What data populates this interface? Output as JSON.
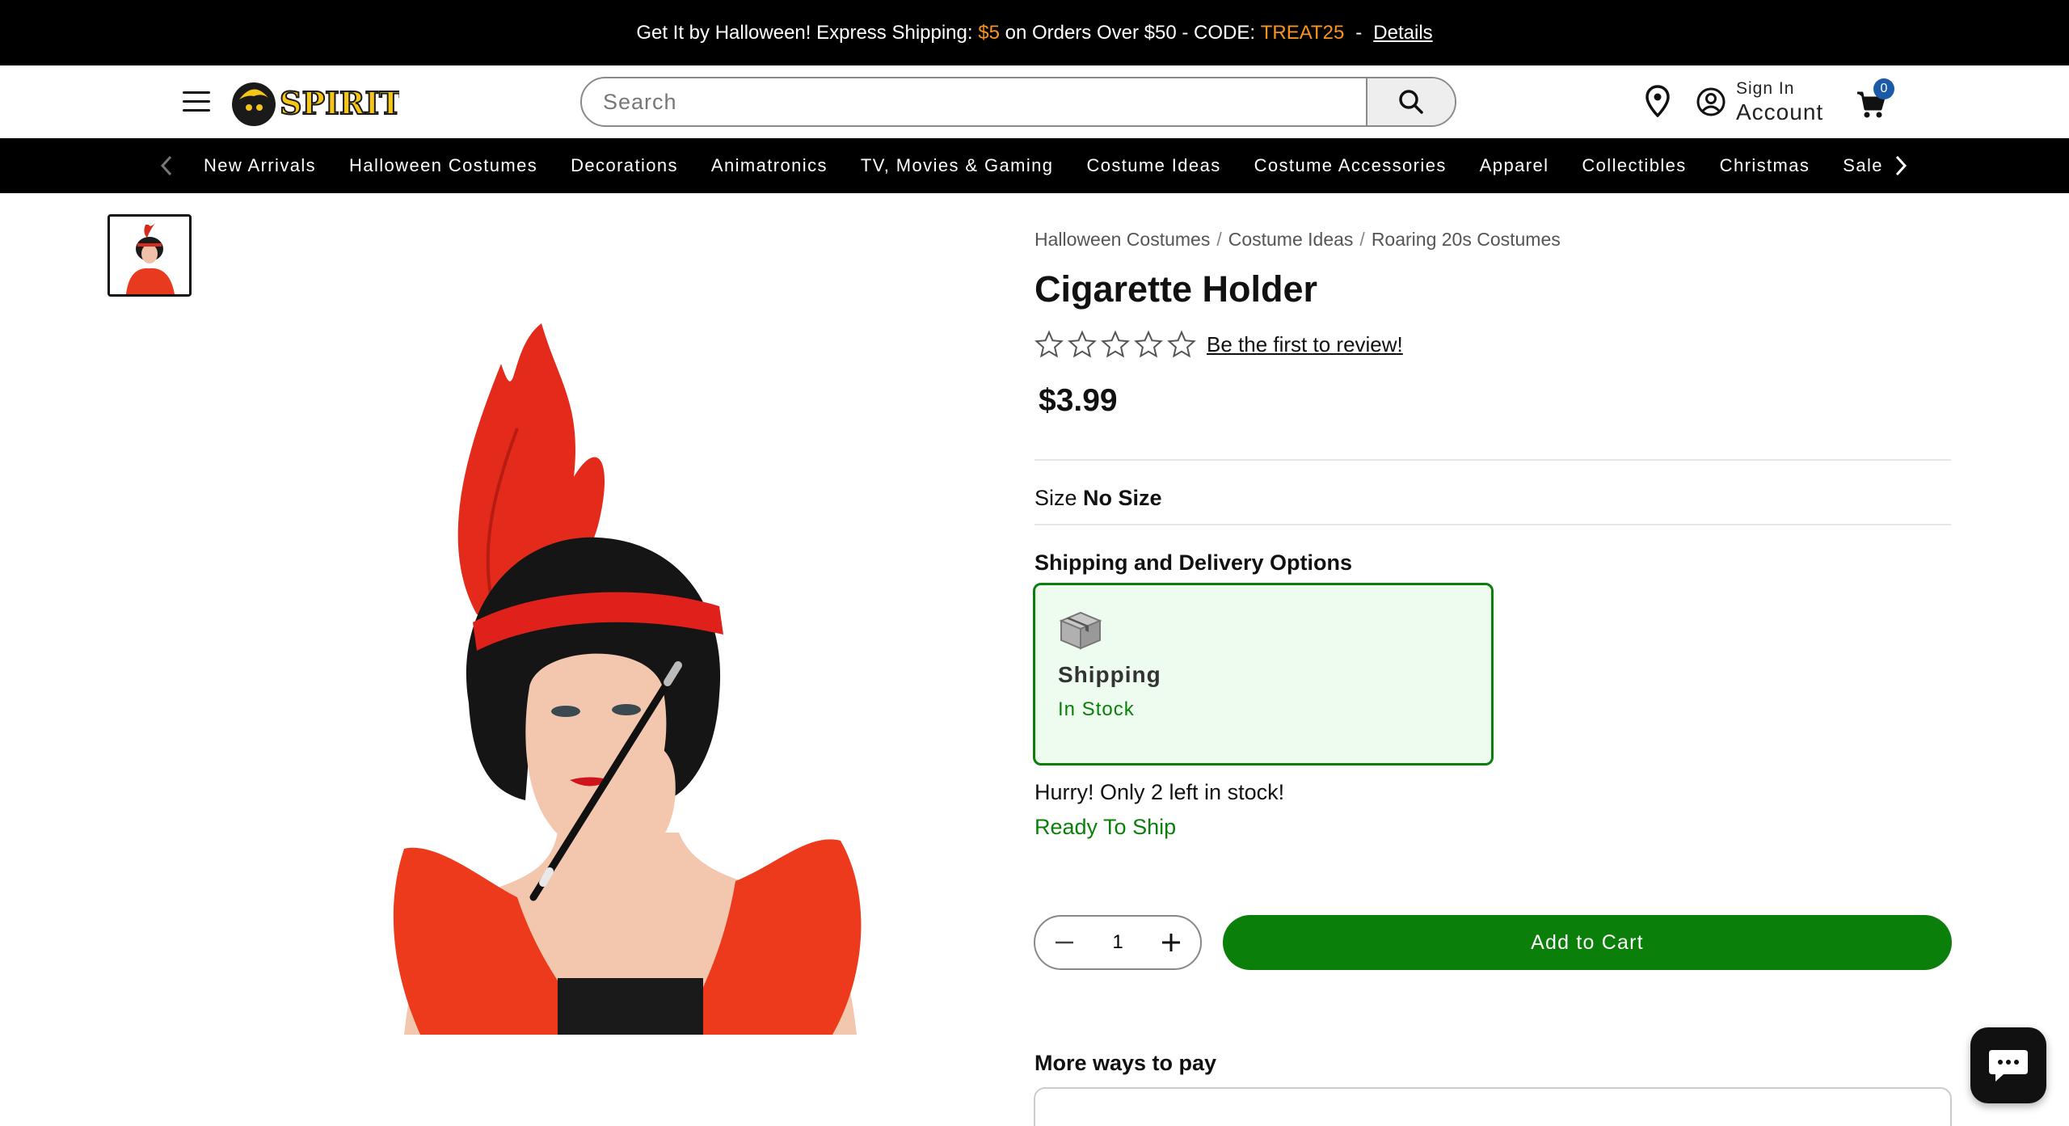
{
  "promo": {
    "text_start": "Get It by Halloween! Express Shipping: ",
    "highlight_amount": "$5",
    "text_mid": " on Orders Over $50 - CODE: ",
    "code": "TREAT25",
    "separator": "-",
    "details_label": "Details"
  },
  "header": {
    "logo_text": "SPIRIT",
    "search_placeholder": "Search",
    "account_small": "Sign In",
    "account_big": "Account",
    "cart_count": "0"
  },
  "nav": {
    "items": [
      "New Arrivals",
      "Halloween Costumes",
      "Decorations",
      "Animatronics",
      "TV, Movies & Gaming",
      "Costume Ideas",
      "Costume Accessories",
      "Apparel",
      "Collectibles",
      "Christmas",
      "Sale"
    ]
  },
  "breadcrumb": [
    "Halloween Costumes",
    "Costume Ideas",
    "Roaring 20s Costumes"
  ],
  "product": {
    "title": "Cigarette Holder",
    "rating": 0,
    "review_link": "Be the first to review!",
    "price": "$3.99",
    "size_label": "Size",
    "size_value": "No Size"
  },
  "shipping": {
    "heading": "Shipping and Delivery Options",
    "option_title": "Shipping",
    "option_status": "In Stock",
    "stock_message": "Hurry! Only 2 left in stock!",
    "ready_message": "Ready To Ship"
  },
  "cart": {
    "quantity": "1",
    "add_label": "Add to Cart"
  },
  "payment": {
    "heading": "More ways to pay"
  },
  "colors": {
    "accent_green": "#0a7f0a",
    "promo_highlight": "#f7941d",
    "badge_blue": "#1a5aa8"
  }
}
